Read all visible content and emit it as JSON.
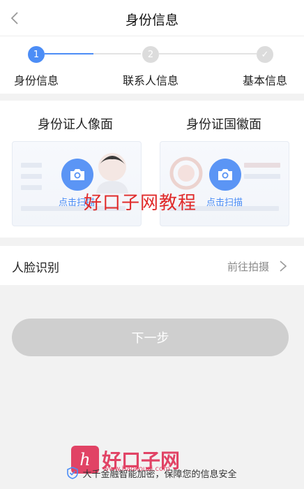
{
  "header": {
    "title": "身份信息"
  },
  "steps": [
    {
      "number": "1",
      "label": "身份信息",
      "state": "active"
    },
    {
      "number": "2",
      "label": "联系人信息",
      "state": "pending"
    },
    {
      "number": "✓",
      "label": "基本信息",
      "state": "pending"
    }
  ],
  "id_cards": {
    "front": {
      "title": "身份证人像面",
      "action": "点击扫描"
    },
    "back": {
      "title": "身份证国徽面",
      "action": "点击扫描"
    }
  },
  "face": {
    "label": "人脸识别",
    "action": "前往拍摄"
  },
  "next_button": "下一步",
  "footer": {
    "text": "大千金融智能加密，保障您的信息安全"
  },
  "watermarks": {
    "center": "好口子网教程",
    "logo_mark": "h",
    "logo_text": "好口子网",
    "logo_url": "www.haokouzi.com"
  },
  "colors": {
    "accent": "#4c8df6",
    "disabled_button": "#cfcfcf",
    "watermark": "#e02a2a"
  }
}
